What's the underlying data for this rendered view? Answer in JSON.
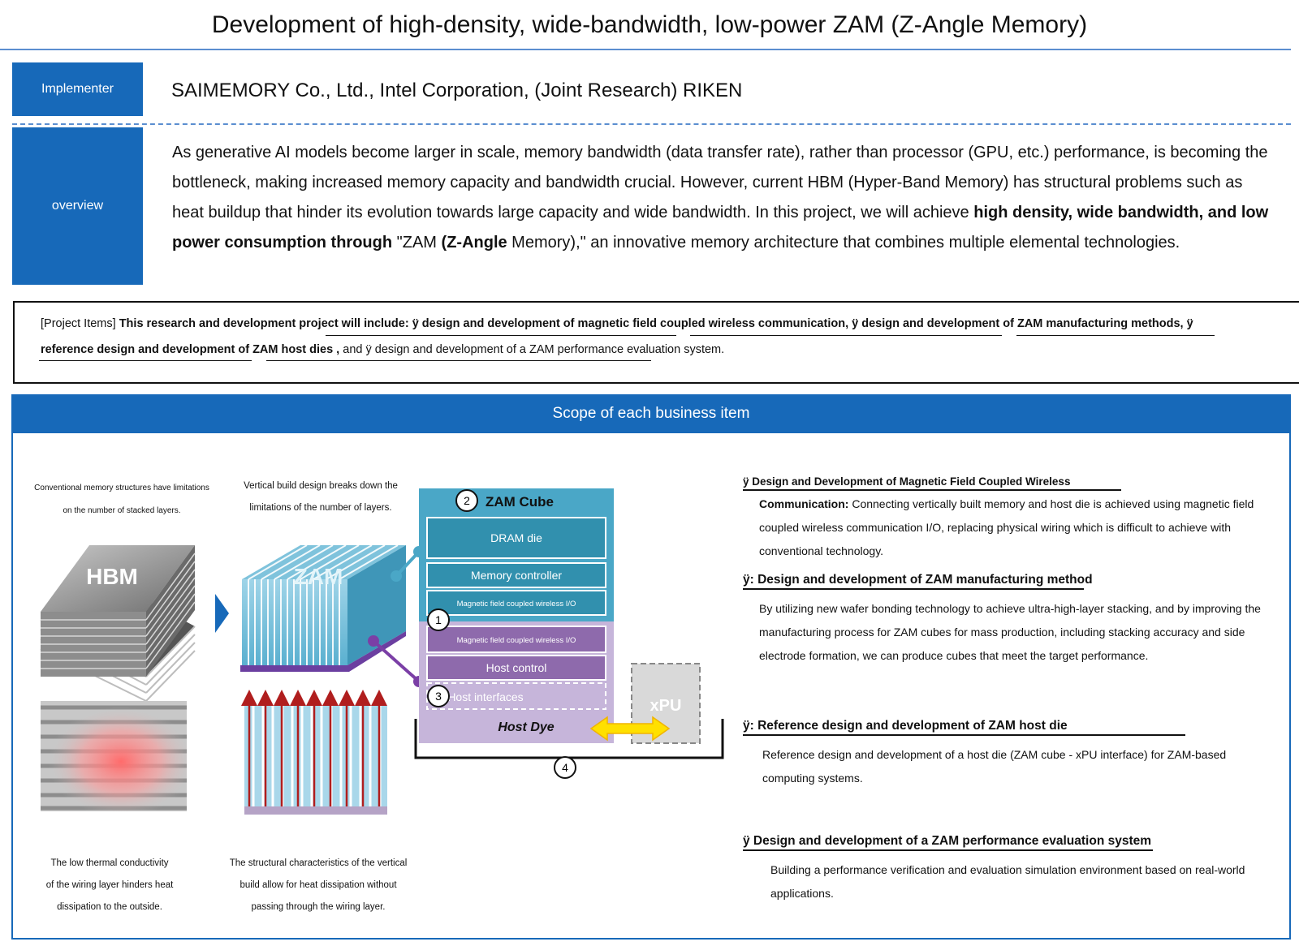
{
  "title": "Development of high-density, wide-bandwidth, low-power ZAM (Z-Angle Memory)",
  "implementer": {
    "label": "Implementer",
    "value": "SAIMEMORY Co., Ltd., Intel Corporation, (Joint Research) RIKEN"
  },
  "overview": {
    "label": "overview",
    "p1": "As generative AI models become larger in scale, memory bandwidth (data transfer rate), rather than processor (GPU, etc.) performance, is becoming the bottleneck, making increased memory capacity and bandwidth crucial. However, current HBM (Hyper-Band Memory) has structural problems such as heat buildup that hinder its evolution towards large capacity and wide bandwidth. In this project, we will achieve ",
    "b1": "high density, wide bandwidth, and low power consumption through",
    "p2": " \"ZAM ",
    "b2": "(Z-Angle",
    "p3": " Memory),\" an innovative memory architecture that combines multiple elemental technologies."
  },
  "project_items": {
    "lead": "[Project Items]",
    "intro": "This research and development project will include:",
    "item1": "ÿ design and development of magnetic field coupled wireless communication,",
    "item2": "ÿ design and development of ZAM manufacturing methods,",
    "item3_a": "ÿ",
    "item3_b": "reference design and development of ZAM host dies ,",
    "item4": "and ÿ design and development of a ZAM performance evaluation system."
  },
  "scope": {
    "header": "Scope of each business item",
    "conv_caption_1": "Conventional memory structures have limitations",
    "conv_caption_2": "on the number of stacked layers.",
    "vert_caption_1": "Vertical build design breaks down the",
    "vert_caption_2": "limitations of the number of layers.",
    "hbm_label": "HBM",
    "zam_label": "ZAM",
    "heat_caption": [
      "The low thermal conductivity",
      "of the wiring layer hinders heat",
      "dissipation to the outside."
    ],
    "vheat_caption": [
      "The structural characteristics of the vertical",
      "build allow for heat dissipation without",
      "passing through the wiring layer."
    ],
    "cube": {
      "title": "ZAM Cube",
      "dram": "DRAM die",
      "memctrl": "Memory controller",
      "wio_top": "Magnetic field coupled wireless I/O",
      "wio_bottom": "Magnetic field coupled wireless I/O",
      "host_control": "Host control",
      "host_if": "Host interfaces",
      "host_dye": "Host Dye",
      "xpu": "xPU"
    },
    "markers": [
      "1",
      "2",
      "3",
      "4"
    ],
    "items": [
      {
        "heading": "ÿ Design and Development of Magnetic Field Coupled Wireless",
        "bold": "Communication:",
        "body": " Connecting vertically built memory and host die is achieved using magnetic field coupled wireless communication I/O, replacing physical wiring which is difficult to achieve with conventional technology."
      },
      {
        "heading": "ÿ: Design and development of ZAM manufacturing method",
        "body": "By utilizing new wafer bonding technology to achieve ultra-high-layer stacking, and by improving the manufacturing process for ZAM cubes for mass production, including stacking accuracy and side electrode formation, we can produce cubes that meet the target performance."
      },
      {
        "heading": "ÿ: Reference design and development of ZAM host die",
        "body": "Reference design and development of a host die (ZAM cube - xPU interface) for ZAM-based computing systems."
      },
      {
        "heading": "ÿ Design and development of a ZAM performance evaluation system",
        "body": "Building a performance verification and evaluation simulation environment based on real-world applications."
      }
    ]
  },
  "colors": {
    "brand_blue": "#1769b9",
    "cube_teal": "#4aa7c7",
    "host_purple": "#8e6aac",
    "heat_red": "#ff6b6b"
  }
}
